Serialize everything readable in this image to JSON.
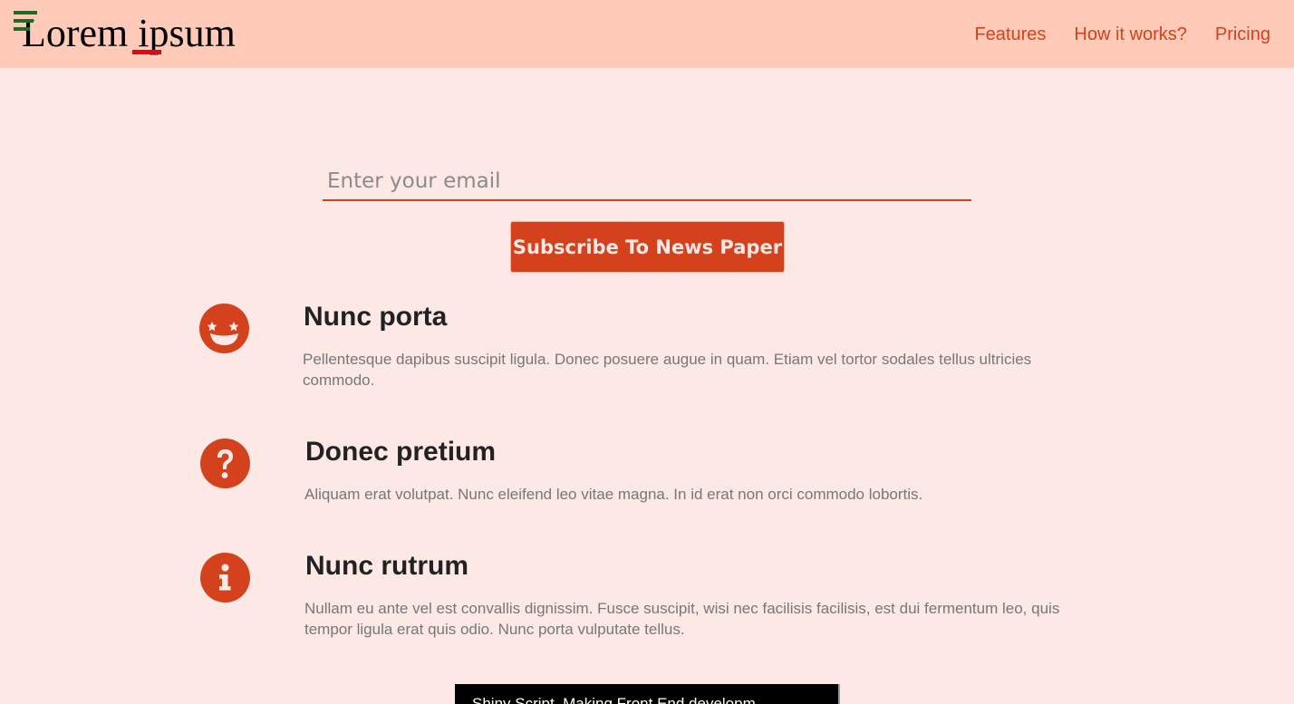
{
  "header": {
    "logo_text": "Lorem ipsum",
    "nav": [
      "Features",
      "How it works?",
      "Pricing"
    ]
  },
  "form": {
    "email_placeholder": "Enter your email",
    "email_value": "",
    "subscribe_label": "Subscribe To News Paper"
  },
  "features": [
    {
      "icon": "grin-stars-icon",
      "title": "Nunc porta",
      "text": "Pellentesque dapibus suscipit ligula. Donec posuere augue in quam. Etiam vel tortor sodales tellus ultricies commodo."
    },
    {
      "icon": "question-circle-icon",
      "title": "Donec pretium",
      "text": "Aliquam erat volutpat. Nunc eleifend leo vitae magna. In id erat non orci commodo lobortis."
    },
    {
      "icon": "info-circle-icon",
      "title": "Nunc rutrum",
      "text": "Nullam eu ante vel est convallis dignissim. Fusce suscipit, wisi nec facilisis facilisis, est dui fermentum leo, quis tempor ligula erat quis odio. Nunc porta vulputate tellus."
    }
  ],
  "video": {
    "title": "Shiny Script, Making Front End developm"
  },
  "colors": {
    "header_bg": "#ffcbb8",
    "page_bg": "#fce9e5",
    "accent": "#d4411d",
    "logo_underline": "#e30613",
    "hamburger": "#1f6b1f"
  }
}
